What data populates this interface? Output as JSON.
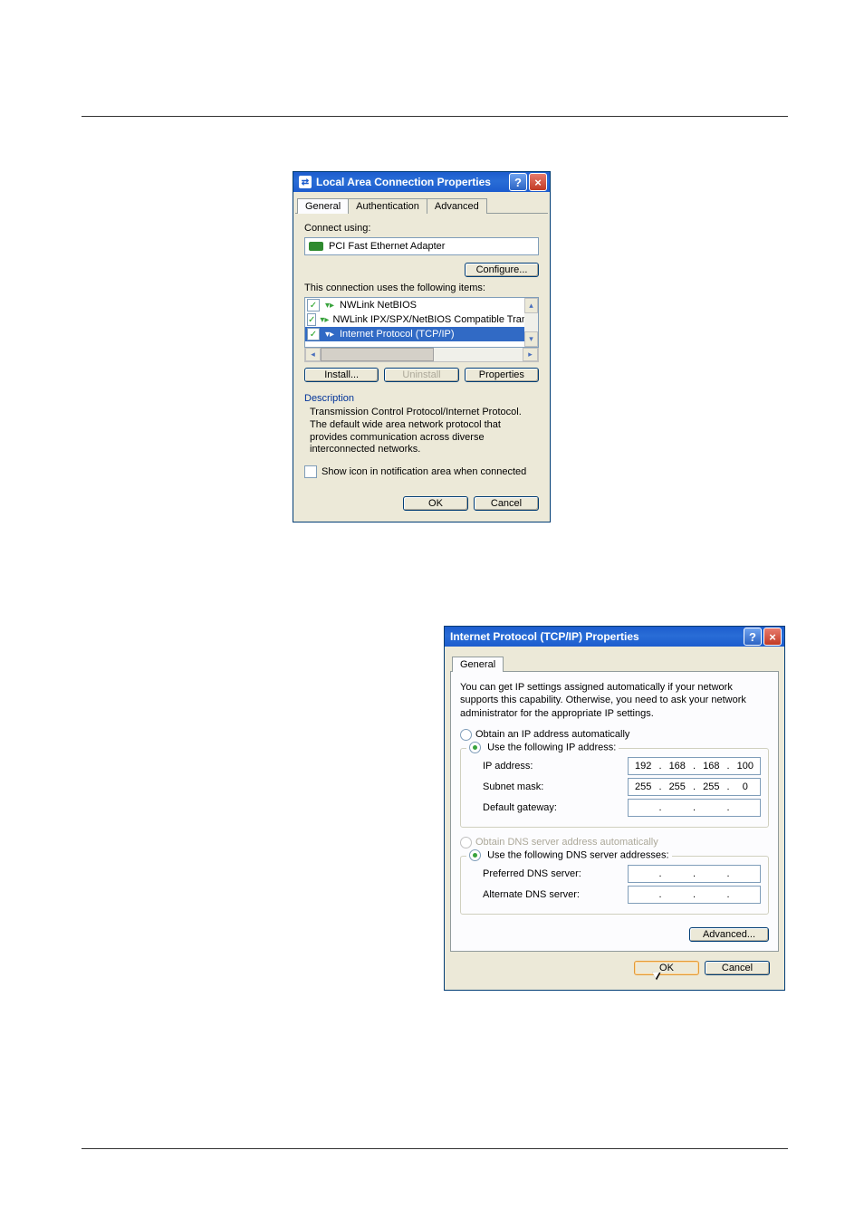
{
  "dialog1": {
    "title": "Local Area Connection Properties",
    "tabs": [
      "General",
      "Authentication",
      "Advanced"
    ],
    "connect_using_label": "Connect using:",
    "adapter": "PCI Fast Ethernet Adapter",
    "configure_btn": "Configure...",
    "items_label": "This connection uses the following items:",
    "list": [
      {
        "checked": true,
        "label": "NWLink NetBIOS"
      },
      {
        "checked": true,
        "label": "NWLink IPX/SPX/NetBIOS Compatible Transport Prot"
      },
      {
        "checked": true,
        "label": "Internet Protocol (TCP/IP)",
        "selected": true
      }
    ],
    "install_btn": "Install...",
    "uninstall_btn": "Uninstall",
    "properties_btn": "Properties",
    "description_label": "Description",
    "description_text": "Transmission Control Protocol/Internet Protocol. The default wide area network protocol that provides communication across diverse interconnected networks.",
    "show_icon_label": "Show icon in notification area when connected",
    "ok_btn": "OK",
    "cancel_btn": "Cancel"
  },
  "dialog2": {
    "title": "Internet Protocol (TCP/IP) Properties",
    "tab": "General",
    "intro": "You can get IP settings assigned automatically if your network supports this capability. Otherwise, you need to ask your network administrator for the appropriate IP settings.",
    "radio_auto_ip": "Obtain an IP address automatically",
    "radio_use_ip": "Use the following IP address:",
    "ip_label": "IP address:",
    "ip_value": [
      "192",
      "168",
      "168",
      "100"
    ],
    "subnet_label": "Subnet mask:",
    "subnet_value": [
      "255",
      "255",
      "255",
      "0"
    ],
    "gateway_label": "Default gateway:",
    "gateway_value": [
      "",
      "",
      "",
      ""
    ],
    "radio_auto_dns": "Obtain DNS server address automatically",
    "radio_use_dns": "Use the following DNS server addresses:",
    "pref_dns_label": "Preferred DNS server:",
    "pref_dns_value": [
      "",
      "",
      "",
      ""
    ],
    "alt_dns_label": "Alternate DNS server:",
    "alt_dns_value": [
      "",
      "",
      "",
      ""
    ],
    "advanced_btn": "Advanced...",
    "ok_btn": "OK",
    "cancel_btn": "Cancel"
  }
}
